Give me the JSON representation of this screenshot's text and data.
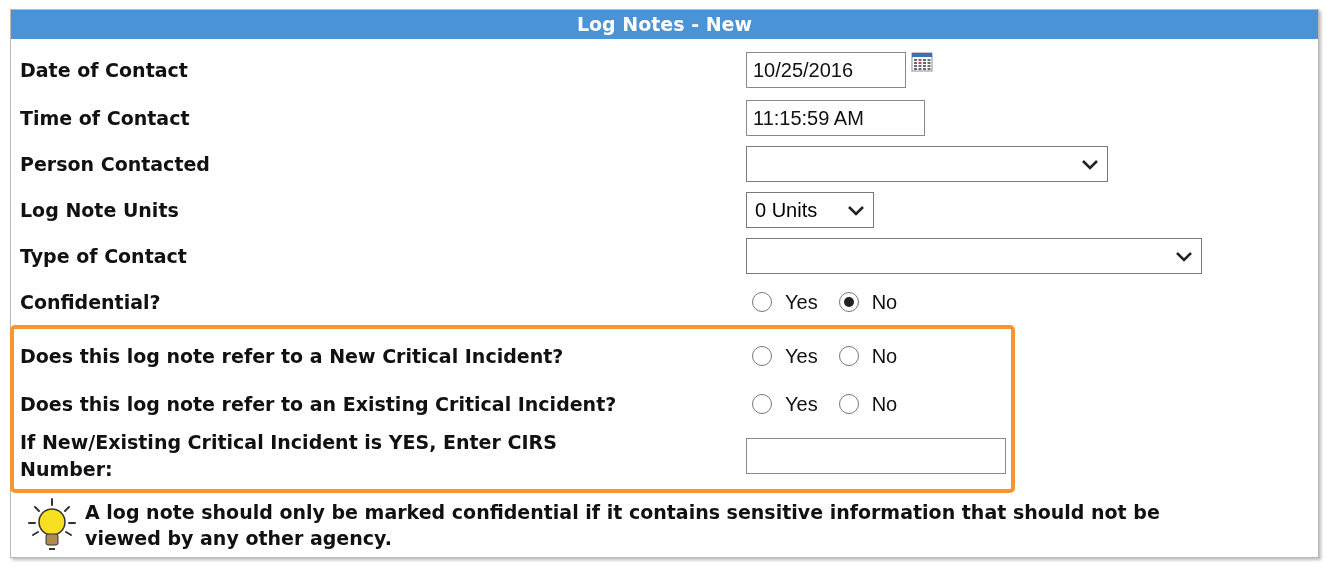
{
  "panel": {
    "title": "Log Notes - New"
  },
  "fields": [
    {
      "kind": "date",
      "label": "Date of Contact",
      "value": "10/25/2016"
    },
    {
      "kind": "text",
      "label": "Time of Contact",
      "value": "11:15:59 AM"
    },
    {
      "kind": "select",
      "label": "Person Contacted"
    },
    {
      "kind": "select",
      "label": "Log Note Units",
      "value": "0 Units"
    },
    {
      "kind": "select",
      "label": "Type of Contact"
    },
    {
      "kind": "radio",
      "label": "Confidential?",
      "options": [
        {
          "label": "Yes",
          "selected": false
        },
        {
          "label": "No",
          "selected": true
        }
      ]
    }
  ],
  "highlighted_fields": [
    {
      "kind": "radio",
      "label": "Does this log note refer to a New Critical Incident?",
      "options": [
        {
          "label": "Yes",
          "selected": false
        },
        {
          "label": "No",
          "selected": false
        }
      ]
    },
    {
      "kind": "radio",
      "label": "Does this log note refer to an Existing Critical Incident?",
      "options": [
        {
          "label": "Yes",
          "selected": false
        },
        {
          "label": "No",
          "selected": false
        }
      ]
    },
    {
      "kind": "text",
      "label": "If New/Existing Critical Incident is YES, Enter CIRS Number:"
    }
  ],
  "tip": "A log note should only be marked confidential if it contains sensitive information that should not be viewed by any other agency."
}
